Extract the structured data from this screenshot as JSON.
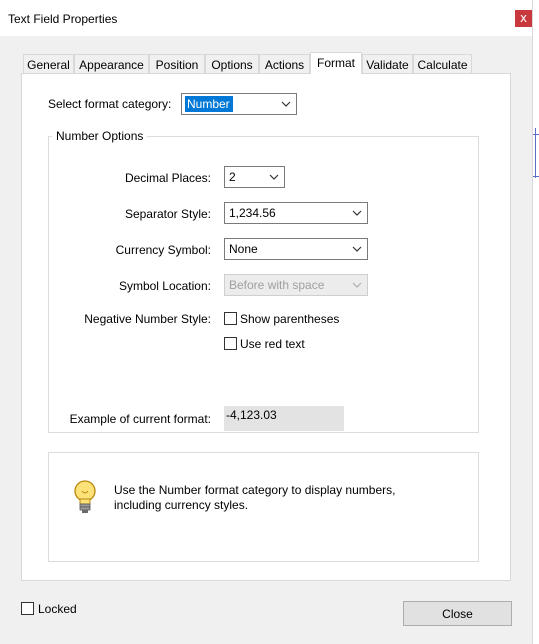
{
  "window": {
    "title": "Text Field Properties",
    "close_glyph": "x"
  },
  "tabs": [
    {
      "label": "General"
    },
    {
      "label": "Appearance"
    },
    {
      "label": "Position"
    },
    {
      "label": "Options"
    },
    {
      "label": "Actions"
    },
    {
      "label": "Format",
      "active": true
    },
    {
      "label": "Validate"
    },
    {
      "label": "Calculate"
    }
  ],
  "format": {
    "category_label": "Select format category:",
    "category_value": "Number"
  },
  "number_options": {
    "legend": "Number Options",
    "decimal_places_label": "Decimal Places:",
    "decimal_places_value": "2",
    "separator_style_label": "Separator Style:",
    "separator_style_value": "1,234.56",
    "currency_symbol_label": "Currency Symbol:",
    "currency_symbol_value": "None",
    "symbol_location_label": "Symbol Location:",
    "symbol_location_value": "Before with space",
    "negative_style_label": "Negative Number Style:",
    "show_parentheses_label": "Show parentheses",
    "show_parentheses_checked": false,
    "use_red_text_label": "Use red text",
    "use_red_text_checked": false,
    "example_label": "Example of current format:",
    "example_value": "-4,123.03"
  },
  "info": {
    "icon": "lightbulb-icon",
    "text": "Use the Number format category to display numbers, including currency styles."
  },
  "footer": {
    "locked_label": "Locked",
    "locked_checked": false,
    "close_label": "Close"
  },
  "colors": {
    "selection": "#0078d7",
    "close_button": "#c8383c"
  }
}
